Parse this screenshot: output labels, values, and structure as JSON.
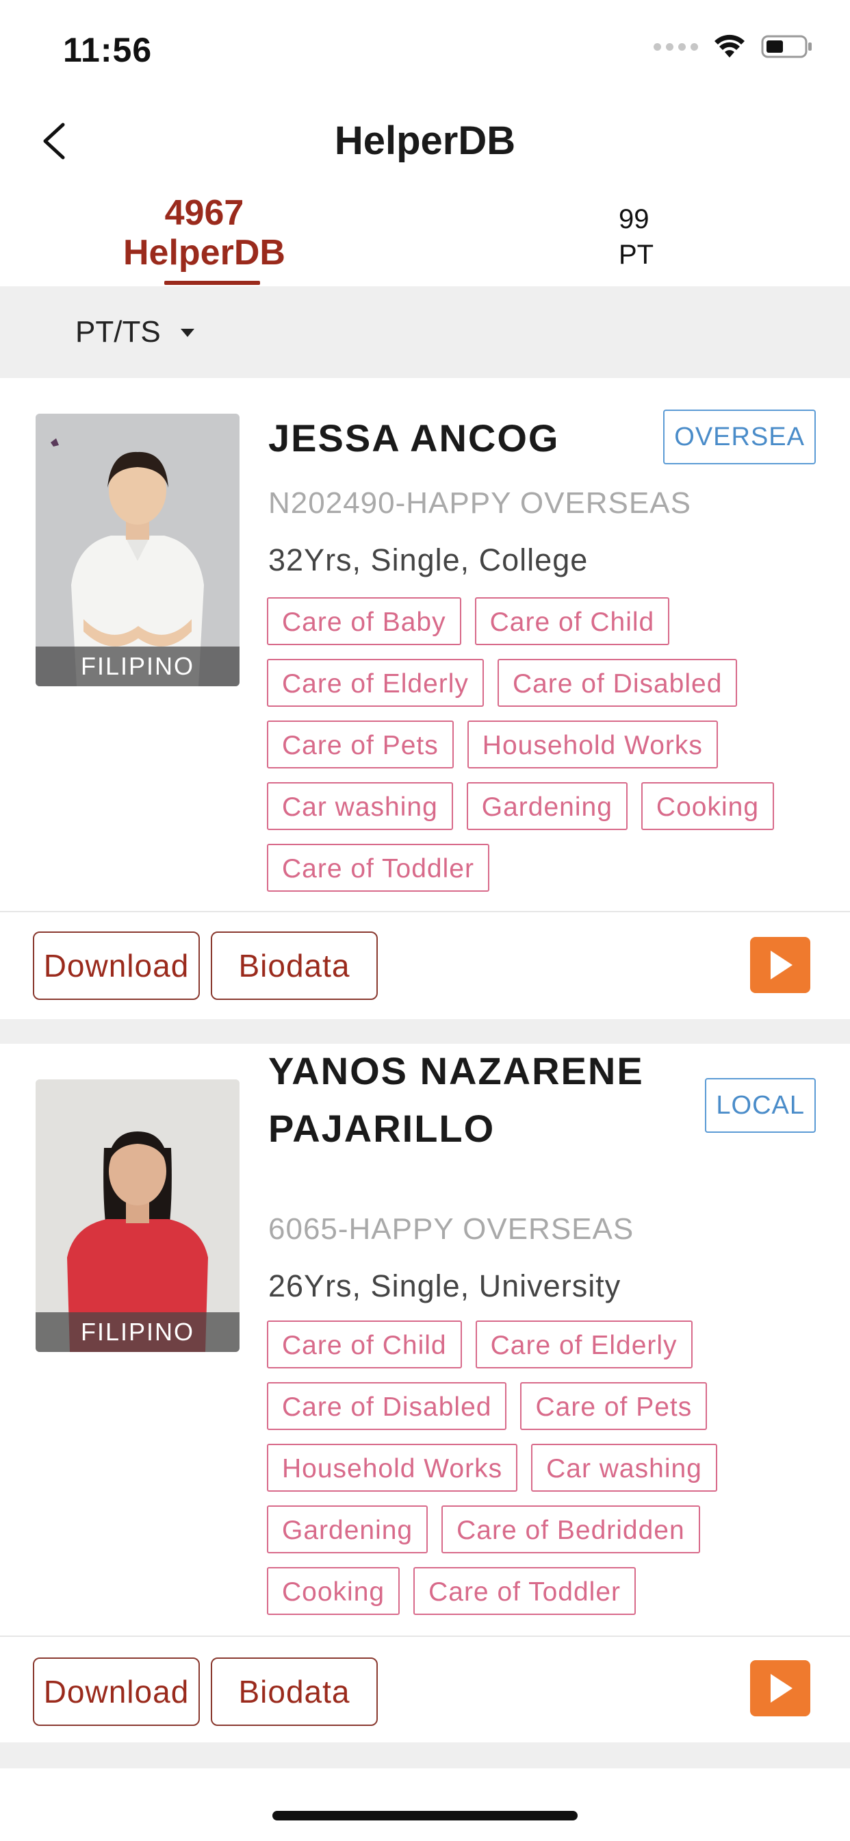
{
  "status_bar": {
    "time": "11:56"
  },
  "nav": {
    "title": "HelperDB"
  },
  "tabs": [
    {
      "count": "4967",
      "label": "HelperDB",
      "active": true
    },
    {
      "count": "99",
      "label": "PT",
      "active": false
    }
  ],
  "filter": {
    "label": "PT/TS"
  },
  "helpers": [
    {
      "name": "JESSA ANCOG",
      "badge": "OVERSEA",
      "agency": "N202490-HAPPY OVERSEAS",
      "details": "32Yrs, Single, College",
      "nationality": "FILIPINO",
      "tags": [
        "Care of Baby",
        "Care of Child",
        "Care of Elderly",
        "Care of Disabled",
        "Care of Pets",
        "Household Works",
        "Car washing",
        "Gardening",
        "Cooking",
        "Care of Toddler"
      ],
      "download_label": "Download",
      "biodata_label": "Biodata"
    },
    {
      "name": "YANOS NAZARENE PAJARILLO",
      "badge": "LOCAL",
      "agency": "6065-HAPPY OVERSEAS",
      "details": "26Yrs, Single, University",
      "nationality": "FILIPINO",
      "tags": [
        "Care of Child",
        "Care of Elderly",
        "Care of Disabled",
        "Care of Pets",
        "Household Works",
        "Car washing",
        "Gardening",
        "Care of Bedridden",
        "Cooking",
        "Care of Toddler"
      ],
      "download_label": "Download",
      "biodata_label": "Biodata"
    }
  ],
  "colors": {
    "accent": "#9a2a1c",
    "tag": "#d86a8a",
    "badge": "#4a8cc9",
    "play": "#ef7a2e"
  }
}
